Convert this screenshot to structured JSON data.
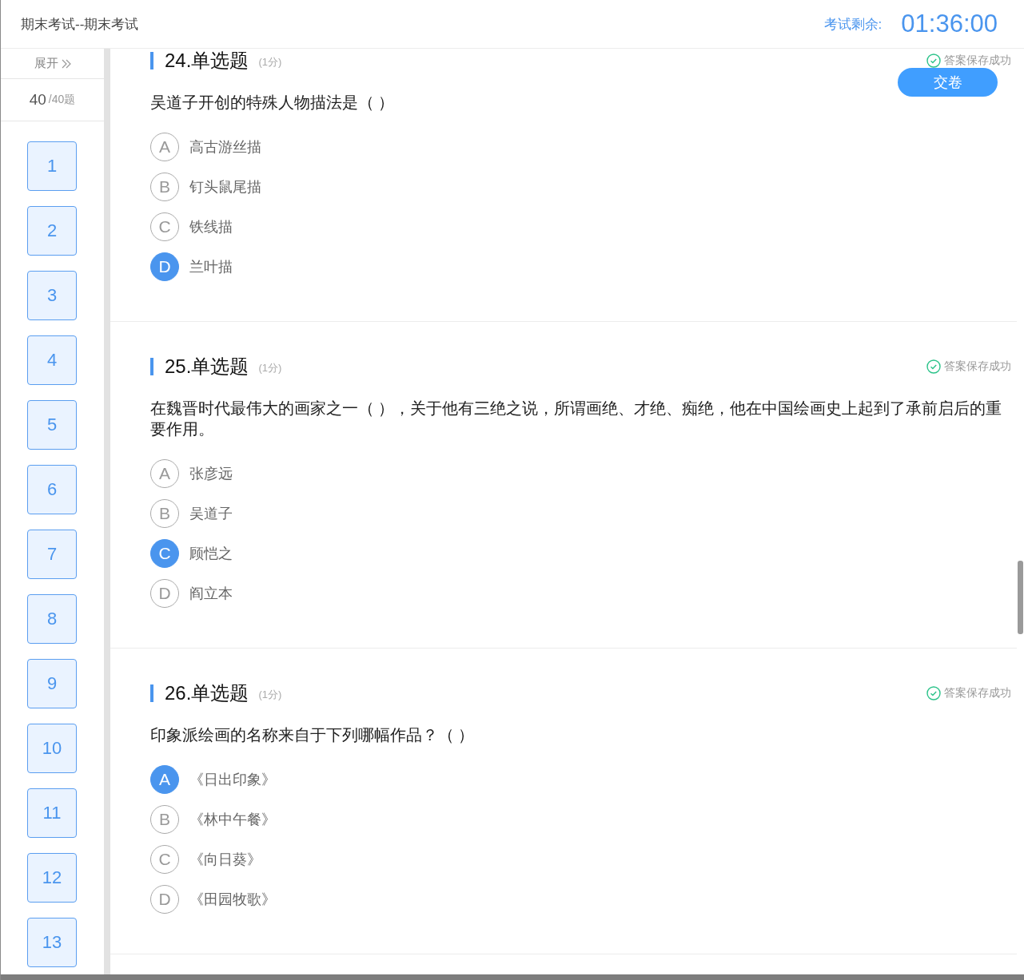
{
  "header": {
    "title": "期末考试--期末考试",
    "timer_label": "考试剩余:",
    "timer": "01:36:00"
  },
  "submit_button": "交卷",
  "sidebar": {
    "toggle": "展开",
    "answered_count": "40",
    "total": "/40题",
    "questions": [
      {
        "label": "1",
        "answered": true
      },
      {
        "label": "2",
        "answered": true
      },
      {
        "label": "3",
        "answered": true
      },
      {
        "label": "4",
        "answered": true
      },
      {
        "label": "5",
        "answered": true
      },
      {
        "label": "6",
        "answered": true
      },
      {
        "label": "7",
        "answered": true
      },
      {
        "label": "8",
        "answered": true
      },
      {
        "label": "9",
        "answered": true
      },
      {
        "label": "10",
        "answered": true
      },
      {
        "label": "11",
        "answered": true
      },
      {
        "label": "12",
        "answered": true
      },
      {
        "label": "13",
        "answered": true
      }
    ]
  },
  "questions": [
    {
      "title": "24.单选题",
      "score": "(1分)",
      "status": "答案保存成功",
      "text": "吴道子开创的特殊人物描法是（ ）",
      "options": [
        {
          "letter": "A",
          "text": "高古游丝描",
          "selected": false
        },
        {
          "letter": "B",
          "text": "钉头鼠尾描",
          "selected": false
        },
        {
          "letter": "C",
          "text": "铁线描",
          "selected": false
        },
        {
          "letter": "D",
          "text": "兰叶描",
          "selected": true
        }
      ]
    },
    {
      "title": "25.单选题",
      "score": "(1分)",
      "status": "答案保存成功",
      "text": "在魏晋时代最伟大的画家之一（ ），关于他有三绝之说，所谓画绝、才绝、痴绝，他在中国绘画史上起到了承前启后的重要作用。",
      "options": [
        {
          "letter": "A",
          "text": "张彦远",
          "selected": false
        },
        {
          "letter": "B",
          "text": "吴道子",
          "selected": false
        },
        {
          "letter": "C",
          "text": "顾恺之",
          "selected": true
        },
        {
          "letter": "D",
          "text": "阎立本",
          "selected": false
        }
      ]
    },
    {
      "title": "26.单选题",
      "score": "(1分)",
      "status": "答案保存成功",
      "text": "印象派绘画的名称来自于下列哪幅作品？（ ）",
      "options": [
        {
          "letter": "A",
          "text": "《日出印象》",
          "selected": true
        },
        {
          "letter": "B",
          "text": "《林中午餐》",
          "selected": false
        },
        {
          "letter": "C",
          "text": "《向日葵》",
          "selected": false
        },
        {
          "letter": "D",
          "text": "《田园牧歌》",
          "selected": false
        }
      ]
    }
  ]
}
